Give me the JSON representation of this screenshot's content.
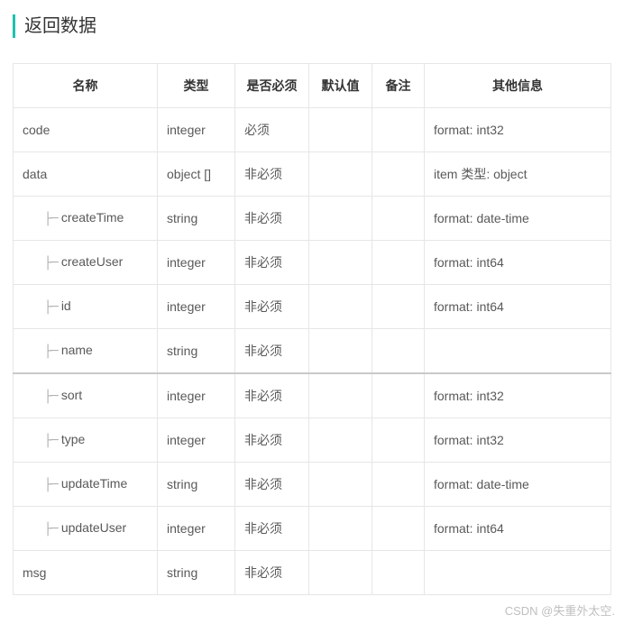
{
  "section_title": "返回数据",
  "columns": [
    "名称",
    "类型",
    "是否必须",
    "默认值",
    "备注",
    "其他信息"
  ],
  "tree_glyph": "├─",
  "rows": [
    {
      "indent": 0,
      "name": "code",
      "type": "integer",
      "required": "必须",
      "default": "",
      "remark": "",
      "other": "format: int32"
    },
    {
      "indent": 0,
      "name": "data",
      "type": "object []",
      "required": "非必须",
      "default": "",
      "remark": "",
      "other": "item 类型: object"
    },
    {
      "indent": 1,
      "name": "createTime",
      "type": "string",
      "required": "非必须",
      "default": "",
      "remark": "",
      "other": "format: date-time"
    },
    {
      "indent": 1,
      "name": "createUser",
      "type": "integer",
      "required": "非必须",
      "default": "",
      "remark": "",
      "other": "format: int64"
    },
    {
      "indent": 1,
      "name": "id",
      "type": "integer",
      "required": "非必须",
      "default": "",
      "remark": "",
      "other": "format: int64"
    },
    {
      "indent": 1,
      "name": "name",
      "type": "string",
      "required": "非必须",
      "default": "",
      "remark": "",
      "other": ""
    },
    {
      "indent": 1,
      "name": "sort",
      "type": "integer",
      "required": "非必须",
      "default": "",
      "remark": "",
      "other": "format: int32",
      "divider": true
    },
    {
      "indent": 1,
      "name": "type",
      "type": "integer",
      "required": "非必须",
      "default": "",
      "remark": "",
      "other": "format: int32"
    },
    {
      "indent": 1,
      "name": "updateTime",
      "type": "string",
      "required": "非必须",
      "default": "",
      "remark": "",
      "other": "format: date-time"
    },
    {
      "indent": 1,
      "name": "updateUser",
      "type": "integer",
      "required": "非必须",
      "default": "",
      "remark": "",
      "other": "format: int64"
    },
    {
      "indent": 0,
      "name": "msg",
      "type": "string",
      "required": "非必须",
      "default": "",
      "remark": "",
      "other": ""
    }
  ],
  "watermark": "CSDN @失重外太空."
}
